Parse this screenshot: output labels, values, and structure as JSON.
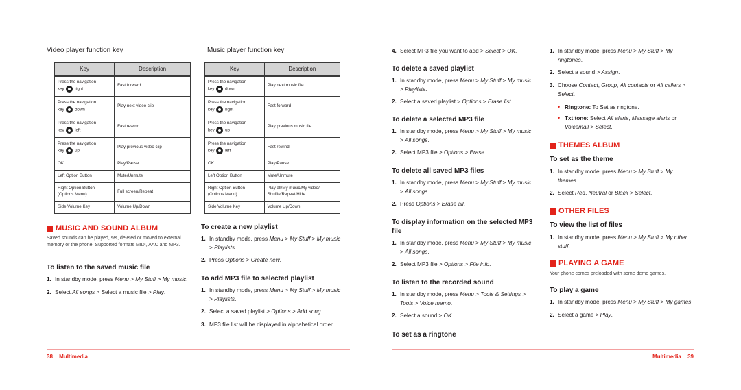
{
  "left_page": {
    "video_table": {
      "title": "Video player function key",
      "headers": [
        "Key",
        "Description"
      ],
      "rows": [
        {
          "key_prefix": "Press the navigation key",
          "icon": "nav-key-right-icon",
          "key_suffix": "right",
          "desc": "Fast forward"
        },
        {
          "key_prefix": "Press the navigation key",
          "icon": "nav-key-down-icon",
          "key_suffix": "down",
          "desc": "Play next video clip"
        },
        {
          "key_prefix": "Press the navigation key",
          "icon": "nav-key-left-icon",
          "key_suffix": "left",
          "desc": "Fast rewind"
        },
        {
          "key_prefix": "Press the navigation key",
          "icon": "nav-key-up-icon",
          "key_suffix": "up",
          "desc": "Play previous video clip"
        },
        {
          "key": "OK",
          "desc": "Play/Pause"
        },
        {
          "key": "Left Option Button",
          "desc": "Mute/Unmute"
        },
        {
          "key": "Right Option Button (Options Menu)",
          "desc": "Full screen/Repeat"
        },
        {
          "key": "Side Volume Key",
          "desc": "Volume Up/Down"
        }
      ]
    },
    "music_table": {
      "title": "Music player function key",
      "headers": [
        "Key",
        "Description"
      ],
      "rows": [
        {
          "key_prefix": "Press the navigation key",
          "icon": "nav-key-down-icon",
          "key_suffix": "down",
          "desc": "Play next music file"
        },
        {
          "key_prefix": "Press the navigation key",
          "icon": "nav-key-right-icon",
          "key_suffix": "right",
          "desc": "Fast forward"
        },
        {
          "key_prefix": "Press the navigation key",
          "icon": "nav-key-up-icon",
          "key_suffix": "up",
          "desc": "Play previous music file"
        },
        {
          "key_prefix": "Press the navigation key",
          "icon": "nav-key-left-icon",
          "key_suffix": "left",
          "desc": "Fast rewind"
        },
        {
          "key": "OK",
          "desc": "Play/Pause"
        },
        {
          "key": "Left Option Button",
          "desc": "Mute/Unmute"
        },
        {
          "key": "Right Option Button (Options Menu)",
          "desc": "Play all/My music/My video/ Shuffle/Repeat/Hide"
        },
        {
          "key": "Side Volume Key",
          "desc": "Volume Up/Down"
        }
      ]
    },
    "music_album": {
      "heading": "MUSIC AND SOUND ALBUM",
      "intro": "Saved sounds can be played, set, deleted or moved to external memory or the phone. Supported formats MIDI, AAC and MP3.",
      "listen": {
        "title": "To listen to the saved music file",
        "steps": [
          "In standby mode, press <i>Menu</i> > <i>My Stuff</i> > <i>My music</i>.",
          "Select <i>All songs</i> > Select a music file > <i>Play</i>."
        ]
      }
    },
    "create_playlist": {
      "title": "To create a new playlist",
      "steps": [
        "In standby mode, press <i>Menu</i> > <i>My Stuff</i> > <i>My music</i> > <i>Playlists</i>.",
        "Press <i>Options</i> > <i>Create new</i>."
      ]
    },
    "add_mp3": {
      "title": "To add MP3 file to selected playlist",
      "steps": [
        "In standby mode, press <i>Menu</i> > <i>My Stuff</i> > <i>My music</i> > <i>Playlists</i>.",
        "Select a saved playlist > <i>Options</i> > <i>Add song</i>.",
        "MP3 file list will be displayed in alphabetical order."
      ]
    },
    "footer": {
      "page_number": "38",
      "section": "Multimedia"
    }
  },
  "right_page": {
    "add_mp3_cont": {
      "steps": [
        {
          "n": "4.",
          "t": "Select MP3 file you want to add > <i>Select</i> > <i>OK</i>."
        }
      ]
    },
    "delete_playlist": {
      "title": "To delete a saved playlist",
      "steps": [
        "In standby mode, press <i>Menu</i> > <i>My Stuff</i> > <i>My music</i> > <i>Playlists</i>.",
        "Select a saved playlist > <i>Options</i> > <i>Erase list</i>."
      ]
    },
    "delete_mp3": {
      "title": "To delete a selected MP3 file",
      "steps": [
        "In standby mode, press <i>Menu</i> > <i>My Stuff</i> > <i>My music</i> > <i>All songs</i>.",
        "Select MP3 file > <i>Options</i> > <i>Erase</i>."
      ]
    },
    "delete_all": {
      "title": "To delete all saved MP3 files",
      "steps": [
        "In standby mode, press <i>Menu</i> > <i>My Stuff</i> > <i>My music</i> > <i>All songs</i>.",
        "Press <i>Options</i> > <i>Erase all</i>."
      ]
    },
    "display_info": {
      "title": "To display information on the selected MP3 file",
      "steps": [
        "In standby mode, press <i>Menu</i> > <i>My Stuff</i> > <i>My music</i> > <i>All songs</i>.",
        "Select MP3 file > <i>Options</i> > <i>File info</i>."
      ]
    },
    "listen_recorded": {
      "title": "To listen to the recorded sound",
      "steps": [
        "In standby mode, press <i>Menu</i> > <i>Tools &amp; Settings</i> > <i>Tools</i> > <i>Voice memo</i>.",
        "Select a sound > <i>OK</i>."
      ]
    },
    "ringtone": {
      "title": "To set as a ringtone",
      "steps": [
        "In standby mode, press <i>Menu</i> > <i>My Stuff</i> > <i>My ringtones</i>.",
        "Select a sound > <i>Assign</i>.",
        "Choose <i>Contact</i>, <i>Group</i>, <i>All contacts</i> or <i>All callers</i> > <i>Select</i>."
      ],
      "bullets": [
        {
          "label": "Ringtone:",
          "text": "To Set as ringtone."
        },
        {
          "label": "Txt tone:",
          "text": "Select <i>All alerts</i>, <i>Message alerts</i> or <i>Voicemail</i> > <i>Select</i>."
        }
      ]
    },
    "themes": {
      "heading": "THEMES ALBUM",
      "title": "To set as the theme",
      "steps": [
        "In standby mode, press <i>Menu</i> > <i>My Stuff</i> > <i>My themes</i>.",
        "Select <i>Red</i>, <i>Neutral</i> or <i>Black</i> > <i>Select</i>."
      ]
    },
    "other_files": {
      "heading": "OTHER FILES",
      "title": "To view the list of files",
      "steps": [
        "In standby mode, press <i>Menu</i> > <i>My Stuff</i> > <i>My other stuff</i>."
      ]
    },
    "game": {
      "heading": "PLAYING A GAME",
      "intro": "Your phone comes preloaded with some demo games.",
      "title": "To play a game",
      "steps": [
        "In standby mode, press <i>Menu</i> > <i>My Stuff</i> > <i>My games</i>.",
        "Select a game > <i>Play</i>."
      ]
    },
    "footer": {
      "section": "Multimedia",
      "page_number": "39"
    }
  },
  "colors": {
    "accent": "#e2231a",
    "footer_rule": "#f4a0a0",
    "table_header_bg": "#d4d4d4"
  }
}
